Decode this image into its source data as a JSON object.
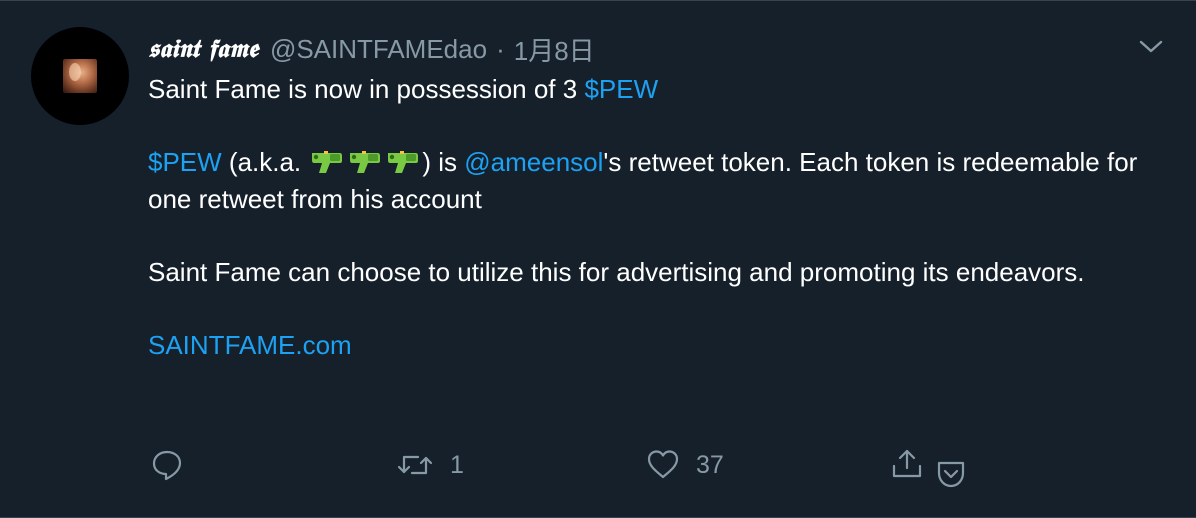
{
  "tweet": {
    "display_name": "𝖘𝖆𝖎𝖓𝖙 𝖋𝖆𝖒𝖊",
    "handle": "@SAINTFAMEdao",
    "separator": "·",
    "date": "1月8日",
    "lines": {
      "p1_text": "Saint Fame is now in possession of 3 ",
      "p1_link": "$PEW",
      "p2_link1": "$PEW",
      "p2_text1": " (a.k.a. ",
      "p2_text2": ") is ",
      "p2_link2": "@ameensol",
      "p2_text3": "'s retweet token. Each token is redeemable for one retweet from his account",
      "p3_text": "Saint Fame can choose to utilize this for advertising and promoting its endeavors.",
      "p4_link": "SAINTFAME.com"
    },
    "emoji_count": 3,
    "emoji_name": "water-pistol-icon"
  },
  "actions": {
    "reply_count": "",
    "retweet_count": "1",
    "like_count": "37"
  },
  "colors": {
    "background": "#15202b",
    "text": "#ffffff",
    "muted": "#8899a6",
    "link": "#1da1f2",
    "divider": "#38444d"
  }
}
